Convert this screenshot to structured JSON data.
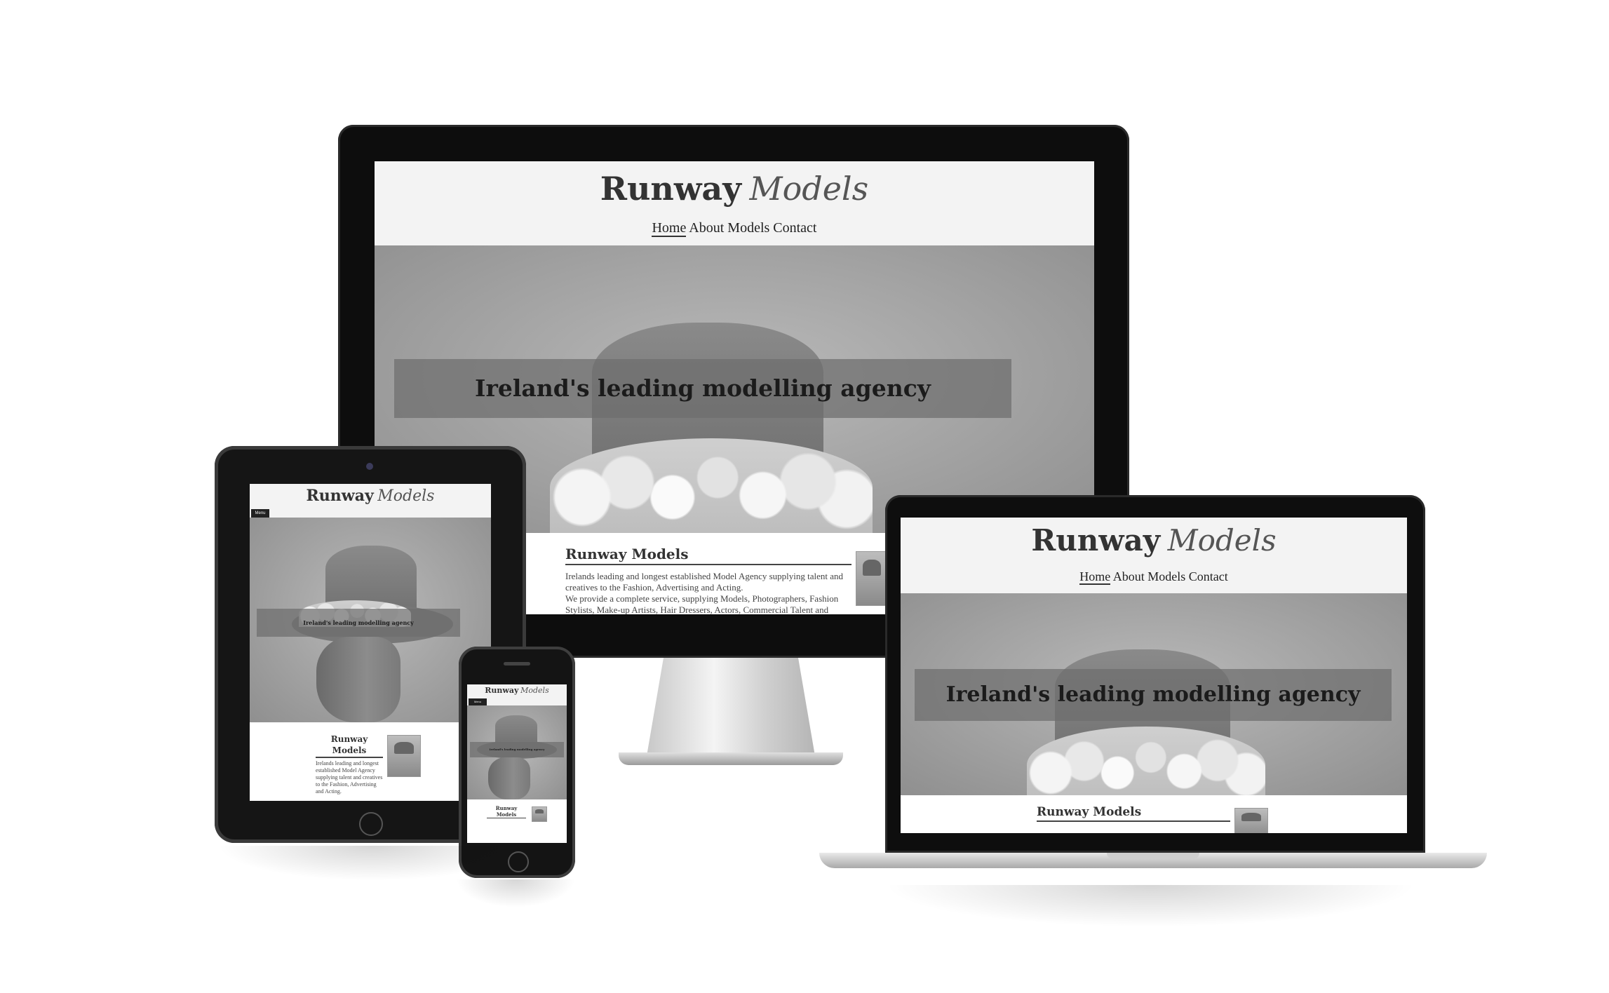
{
  "site": {
    "logo_part1": "Runway",
    "logo_part2": "Models",
    "nav": [
      "Home",
      "About",
      "Models",
      "Contact"
    ],
    "hero_banner": "Ireland's leading modelling agency",
    "menu_label": "Menu",
    "intro_title": "Runway Models",
    "intro_line1": "Irelands leading and longest established Model Agency supplying talent and",
    "intro_line2": "creatives to the Fashion, Advertising and Acting.",
    "intro_line3": "We provide a complete service, supplying Models, Photographers, Fashion",
    "intro_line4": "Stylists, Make-up Artists, Hair Dressers, Actors, Commercial Talent and",
    "intro_full": "Irelands leading and longest established Model Agency supplying talent and creatives to the Fashion, Advertising and Acting.",
    "intro_more": "We provide a complete service"
  },
  "colors": {
    "device_bezel": "#111111",
    "page_bg": "#ffffff",
    "header_bg": "#f3f3f3",
    "banner_bg": "#6e6e6e"
  }
}
